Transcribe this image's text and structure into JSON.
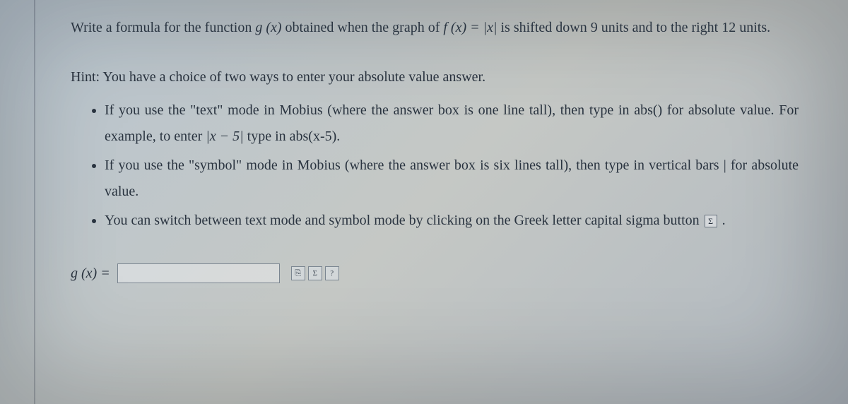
{
  "question": {
    "pre": "Write a formula for the function ",
    "g_of_x": "g (x)",
    "mid1": " obtained when the graph of ",
    "f_expr": "f (x) = |x|",
    "mid2": " is shifted down ",
    "down_units": "9",
    "mid3": " units and to the right ",
    "right_units": "12",
    "mid4": " units."
  },
  "hint_lead": "Hint: You have a choice of two ways to enter your absolute value answer.",
  "hints": {
    "b1a": "If you use the \"text\" mode in Mobius (where the answer box is one line tall), then type in abs() for absolute value. For example, to enter ",
    "b1_math": "|x − 5|",
    "b1b": " type in abs(x-5).",
    "b2": "If you use the \"symbol\" mode in Mobius (where the answer box is six lines tall), then type in vertical bars | for absolute value.",
    "b3a": "You can switch between text mode and symbol mode by clicking on the Greek letter capital sigma button ",
    "b3_sigma": "Σ",
    "b3b": " ."
  },
  "answer": {
    "label_pre": "g (x) = ",
    "value": "",
    "placeholder": ""
  },
  "icons": {
    "preview": "⎘",
    "sigma": "Σ",
    "help": "?"
  }
}
